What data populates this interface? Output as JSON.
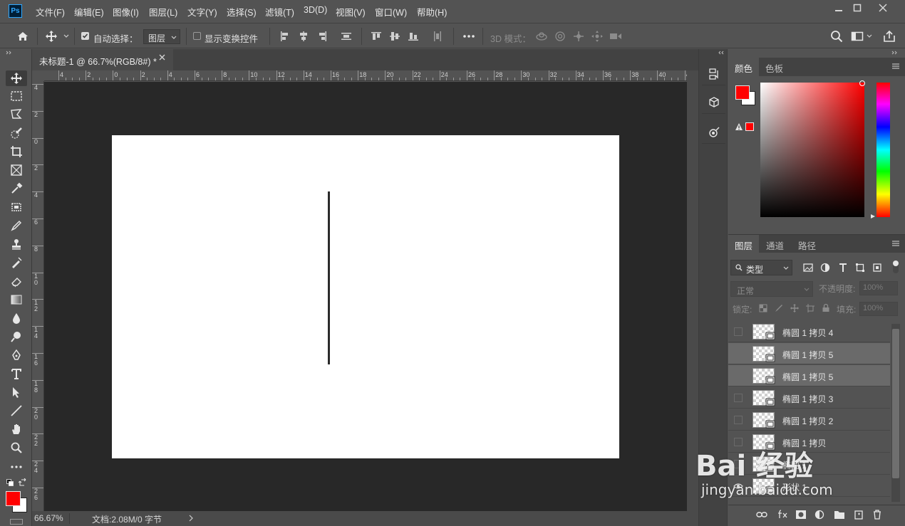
{
  "menubar": {
    "items": [
      "文件(F)",
      "编辑(E)",
      "图像(I)",
      "图层(L)",
      "文字(Y)",
      "选择(S)",
      "滤镜(T)",
      "3D(D)",
      "视图(V)",
      "窗口(W)",
      "帮助(H)"
    ],
    "logo": "Ps"
  },
  "options": {
    "auto_select_label": "自动选择：",
    "auto_select_value": "图层",
    "show_transform_label": "显示变换控件",
    "mode_3d_label": "3D 模式："
  },
  "document": {
    "tab_title": "未标题-1 @ 66.7%(RGB/8#) *",
    "ruler_h": [
      "4",
      "2",
      "0",
      "2",
      "4",
      "6",
      "8",
      "10",
      "12",
      "14",
      "16",
      "18",
      "20",
      "22",
      "24",
      "26",
      "28",
      "30",
      "32",
      "34",
      "36",
      "38",
      "40",
      "42"
    ],
    "ruler_v": [
      "4",
      "2",
      "0",
      "2",
      "4",
      "6",
      "8",
      "1\n0",
      "1\n2",
      "1\n4",
      "1\n6",
      "1\n8",
      "2\n0",
      "2\n2",
      "2\n4",
      "2\n6"
    ]
  },
  "status": {
    "zoom": "66.67%",
    "doc_info": "文档:2.08M/0 字节"
  },
  "color_panel": {
    "tabs": [
      "颜色",
      "色板"
    ],
    "foreground": "#ff0000",
    "background": "#ffffff"
  },
  "layers_panel": {
    "tabs": [
      "图层",
      "通道",
      "路径"
    ],
    "filter_label": "类型",
    "blend_mode": "正常",
    "opacity_label": "不透明度:",
    "opacity_value": "100%",
    "lock_label": "锁定:",
    "fill_label": "填充:",
    "fill_value": "100%",
    "layers": [
      {
        "name": "椭圆 1 拷贝 4",
        "visible": false,
        "selected": false
      },
      {
        "name": "椭圆 1 拷贝 5",
        "visible": false,
        "selected": true
      },
      {
        "name": "椭圆 1 拷贝 5",
        "visible": false,
        "selected": true
      },
      {
        "name": "椭圆 1 拷贝 3",
        "visible": false,
        "selected": false
      },
      {
        "name": "椭圆 1 拷贝 2",
        "visible": false,
        "selected": false
      },
      {
        "name": "椭圆 1 拷贝",
        "visible": false,
        "selected": false
      },
      {
        "name": "椭圆 1",
        "visible": false,
        "selected": false
      },
      {
        "name": "形状 1",
        "visible": true,
        "selected": false
      }
    ]
  },
  "watermark": {
    "brand": "Bai 经验",
    "url": "jingyan.baidu.com"
  }
}
